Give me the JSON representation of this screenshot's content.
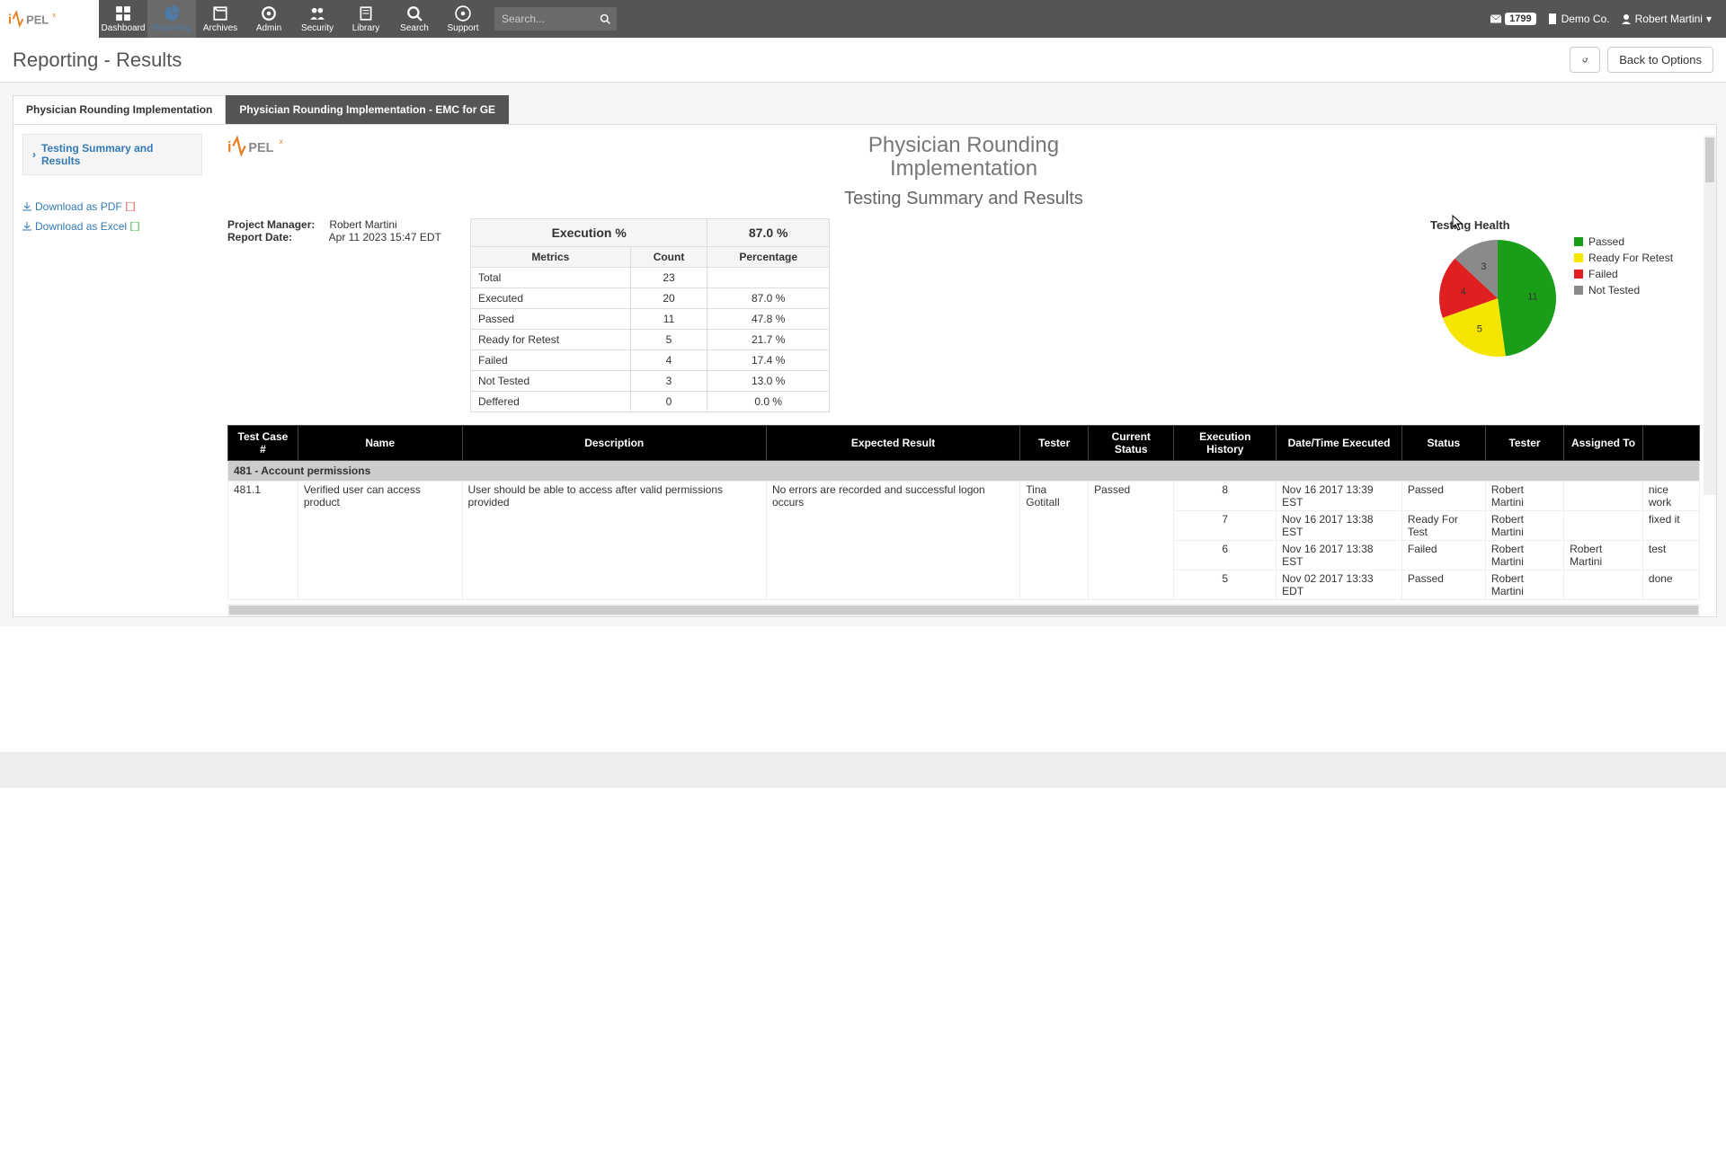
{
  "nav": {
    "items": [
      "Dashboard",
      "Reporting",
      "Archives",
      "Admin",
      "Security",
      "Library",
      "Search",
      "Support"
    ],
    "active_index": 1
  },
  "search": {
    "placeholder": "Search..."
  },
  "topright": {
    "badge": "1799",
    "company": "Demo Co.",
    "user": "Robert Martini"
  },
  "page": {
    "title": "Reporting - Results",
    "back": "Back to Options"
  },
  "tabs": [
    {
      "label": "Physician Rounding Implementation",
      "active": true
    },
    {
      "label": "Physician Rounding Implementation - EMC for GE",
      "active": false
    }
  ],
  "sidebar": {
    "tree_item": "Testing Summary and Results",
    "dl_pdf": "Download as PDF",
    "dl_excel": "Download as Excel"
  },
  "report": {
    "title_line1": "Physician Rounding",
    "title_line2": "Implementation",
    "subtitle": "Testing Summary and Results",
    "pm_label": "Project Manager:",
    "pm_value": "Robert Martini",
    "date_label": "Report Date:",
    "date_value": "Apr 11 2023 15:47 EDT",
    "exec_label": "Execution %",
    "exec_value": "87.0 %",
    "metrics_header": [
      "Metrics",
      "Count",
      "Percentage"
    ],
    "metrics_rows": [
      {
        "m": "Total",
        "c": "23",
        "p": ""
      },
      {
        "m": "Executed",
        "c": "20",
        "p": "87.0 %"
      },
      {
        "m": "Passed",
        "c": "11",
        "p": "47.8 %"
      },
      {
        "m": "Ready for Retest",
        "c": "5",
        "p": "21.7 %"
      },
      {
        "m": "Failed",
        "c": "4",
        "p": "17.4 %"
      },
      {
        "m": "Not Tested",
        "c": "3",
        "p": "13.0 %"
      },
      {
        "m": "Deffered",
        "c": "0",
        "p": "0.0 %"
      }
    ],
    "chart_title": "Testing Health",
    "legend": [
      {
        "label": "Passed",
        "color": "#1a9e1a"
      },
      {
        "label": "Ready For Retest",
        "color": "#f5e600"
      },
      {
        "label": "Failed",
        "color": "#e02020"
      },
      {
        "label": "Not Tested",
        "color": "#8a8a8a"
      }
    ]
  },
  "results": {
    "headers": [
      "Test Case #",
      "Name",
      "Description",
      "Expected Result",
      "Tester",
      "Current Status",
      "Execution History",
      "Date/Time Executed",
      "Status",
      "Tester",
      "Assigned To",
      ""
    ],
    "group": "481 - Account permissions",
    "row": {
      "tc": "481.1",
      "name": "Verified user can access product",
      "desc": "User should be able to access after valid permissions provided",
      "exp": "No errors are recorded and successful logon occurs",
      "tester": "Tina Gotitall",
      "status": "Passed"
    },
    "history": [
      {
        "n": "8",
        "dt": "Nov 16 2017 13:39 EST",
        "st": "Passed",
        "t": "Robert Martini",
        "a": "",
        "c": "nice work"
      },
      {
        "n": "7",
        "dt": "Nov 16 2017 13:38 EST",
        "st": "Ready For Test",
        "t": "Robert Martini",
        "a": "",
        "c": "fixed it"
      },
      {
        "n": "6",
        "dt": "Nov 16 2017 13:38 EST",
        "st": "Failed",
        "t": "Robert Martini",
        "a": "Robert Martini",
        "c": "test"
      },
      {
        "n": "5",
        "dt": "Nov 02 2017 13:33 EDT",
        "st": "Passed",
        "t": "Robert Martini",
        "a": "",
        "c": "done"
      }
    ]
  },
  "chart_data": {
    "type": "pie",
    "title": "Testing Health",
    "series": [
      {
        "name": "Passed",
        "value": 11,
        "color": "#1a9e1a"
      },
      {
        "name": "Ready For Retest",
        "value": 5,
        "color": "#f5e600"
      },
      {
        "name": "Failed",
        "value": 4,
        "color": "#e02020"
      },
      {
        "name": "Not Tested",
        "value": 3,
        "color": "#8a8a8a"
      }
    ]
  }
}
